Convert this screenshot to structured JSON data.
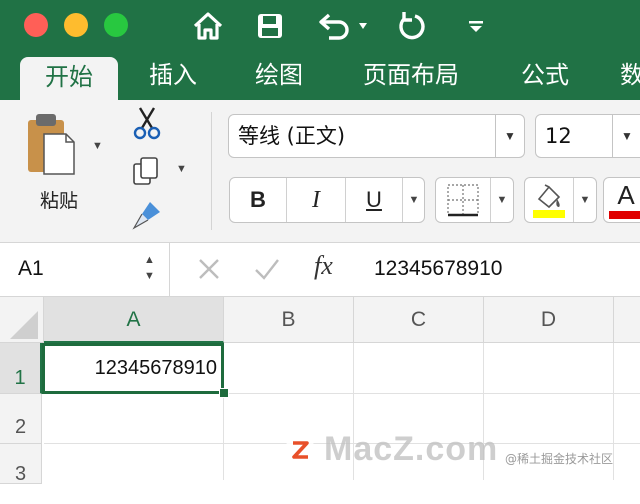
{
  "titlebar": {
    "window_controls": [
      "close",
      "minimize",
      "zoom"
    ],
    "toolbar_icons": [
      "home-icon",
      "save-icon",
      "undo-icon",
      "redo-icon",
      "customize-toolbar-icon"
    ]
  },
  "tabs": [
    {
      "label": "开始",
      "active": true
    },
    {
      "label": "插入",
      "active": false
    },
    {
      "label": "绘图",
      "active": false
    },
    {
      "label": "页面布局",
      "active": false
    },
    {
      "label": "公式",
      "active": false
    },
    {
      "label": "数",
      "active": false
    }
  ],
  "ribbon": {
    "paste_label": "粘贴",
    "font_name": "等线 (正文)",
    "font_size": "12",
    "bold_label": "B",
    "italic_label": "I",
    "underline_label": "U",
    "font_color_label": "A",
    "highlight_color": "#ffff00",
    "font_color": "#e00000"
  },
  "formula_bar": {
    "name_box": "A1",
    "fx_label": "fx",
    "content": "12345678910"
  },
  "grid": {
    "columns": [
      "A",
      "B",
      "C",
      "D"
    ],
    "rows": [
      "1",
      "2",
      "3"
    ],
    "selected_cell": "A1",
    "cells": {
      "A1": "12345678910"
    }
  },
  "watermark": {
    "text": "MacZ.com",
    "credit": "@稀土掘金技术社区"
  },
  "colors": {
    "brand_green": "#207245",
    "ribbon_bg": "#f3f3f3",
    "selection_green": "#1e6b3d"
  }
}
